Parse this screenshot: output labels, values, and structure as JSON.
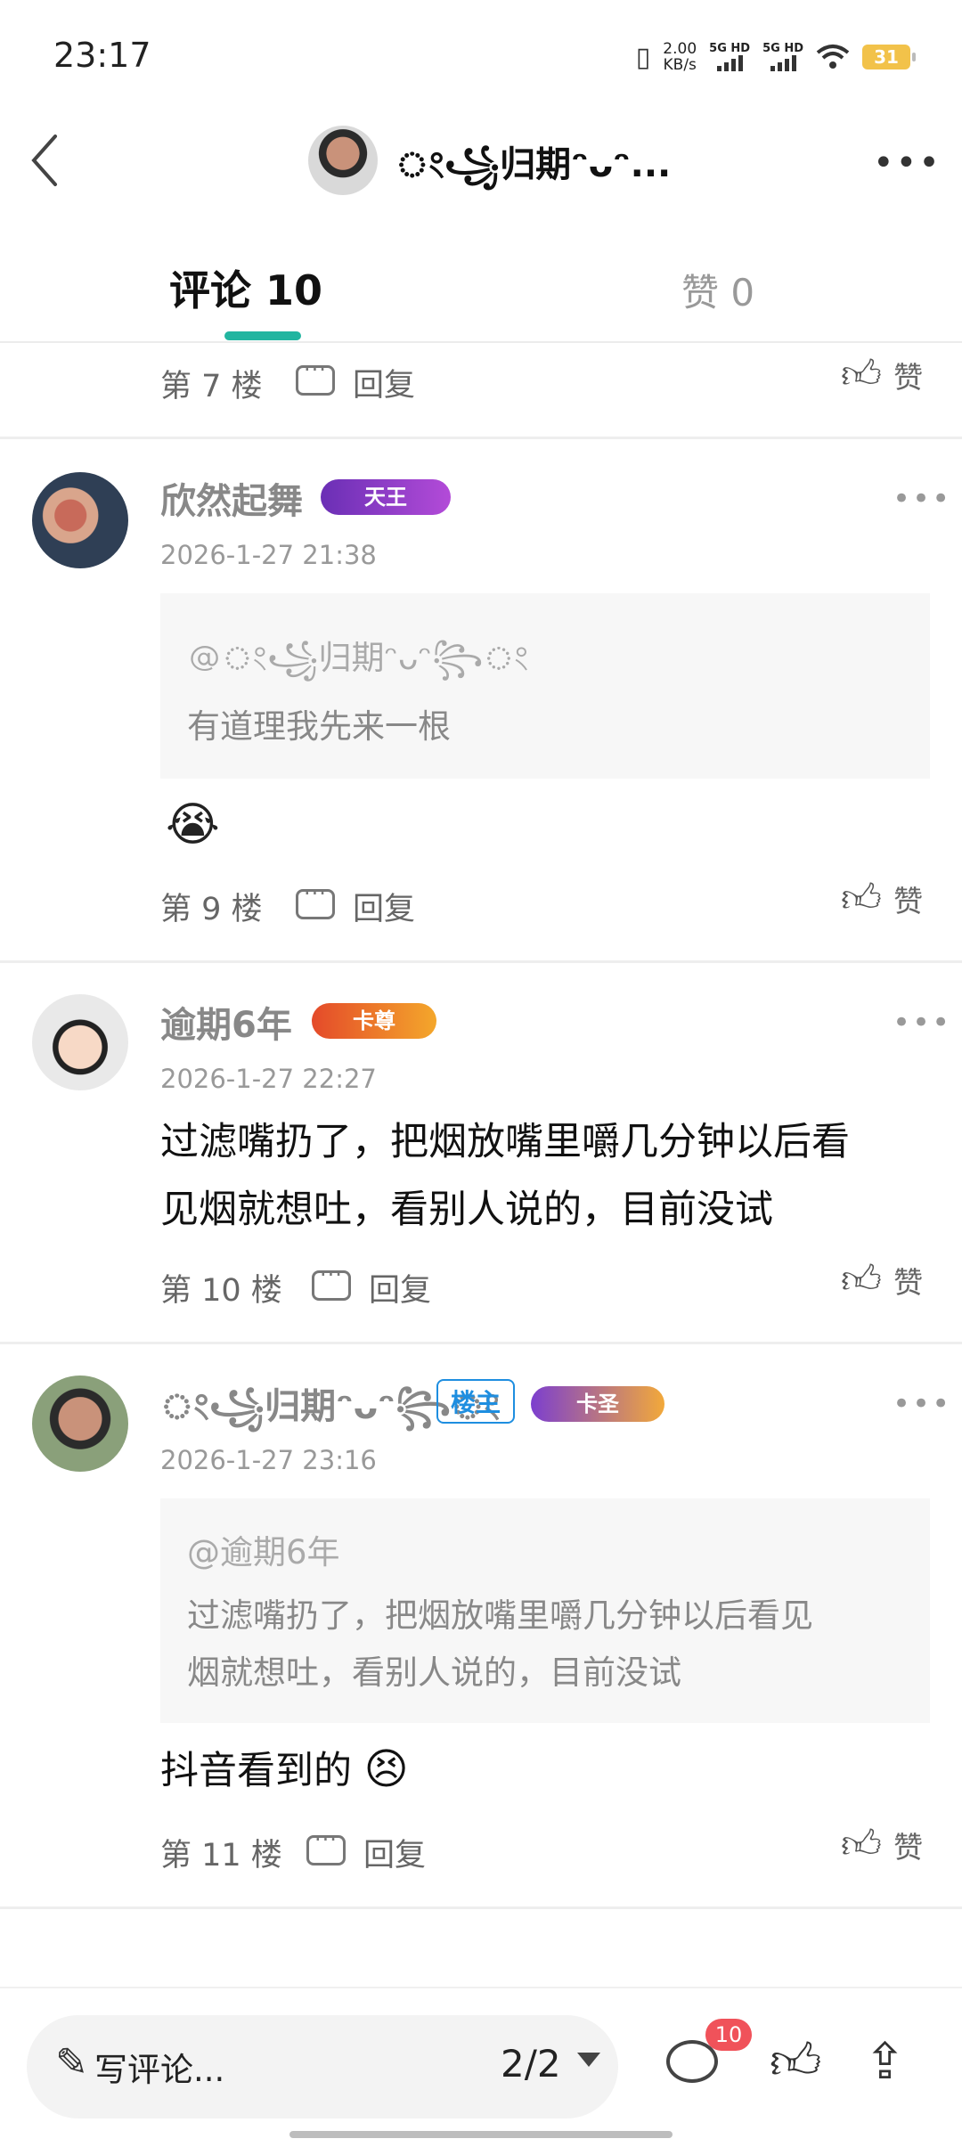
{
  "status_bar": {
    "time": "23:17",
    "speed": "2.00",
    "speed_unit": "KB/s",
    "signal1": "5G HD",
    "signal2": "5G HD",
    "battery": "31",
    "icons": [
      "vibrate-icon",
      "signal-icon",
      "signal-icon",
      "wifi-icon",
      "battery-icon"
    ]
  },
  "header": {
    "name": "ং⁠꧁归期ᵔᴗᵔ...",
    "more_label": "•••"
  },
  "tabs": [
    {
      "label": "评论 10"
    },
    {
      "label": "赞 0"
    }
  ],
  "top_partial": {
    "floor": "第 7 楼",
    "reply": "回复",
    "like": "赞"
  },
  "comments": [
    {
      "user": "欣然起舞",
      "badge": "天王",
      "date": "2026-1-27 21:38",
      "quote_at": "@ং꧁归期ᵔᴗᵔ꧂ং",
      "quote_text": "有道理我先来一根",
      "emoji": "😭",
      "floor": "第 9 楼",
      "reply": "回复",
      "like": "赞"
    },
    {
      "user": "逾期6年",
      "badge": "卡尊",
      "date": "2026-1-27 22:27",
      "text_line1": "过滤嘴扔了，把烟放嘴里嚼几分钟以后看",
      "text_line2": "见烟就想吐，看别人说的，目前没试",
      "floor": "第 10 楼",
      "reply": "回复",
      "like": "赞"
    },
    {
      "user": "ং꧁归期ᵔᴗᵔ꧂ং",
      "owner_tag": "楼主",
      "badge": "卡圣",
      "date": "2026-1-27 23:16",
      "quote_at": "@逾期6年",
      "quote_line1": "过滤嘴扔了，把烟放嘴里嚼几分钟以后看见",
      "quote_line2": "烟就想吐，看别人说的，目前没试",
      "text": "抖音看到的",
      "emoji": "😣",
      "floor": "第 11 楼",
      "reply": "回复",
      "like": "赞"
    }
  ],
  "bottom_bar": {
    "write_label": "写评论...",
    "page_indicator": "2/2",
    "comment_count": "10"
  },
  "colors": {
    "accent": "#22b5a0",
    "badge_red": "#f0525a",
    "owner_tag": "#1e8ee0"
  }
}
